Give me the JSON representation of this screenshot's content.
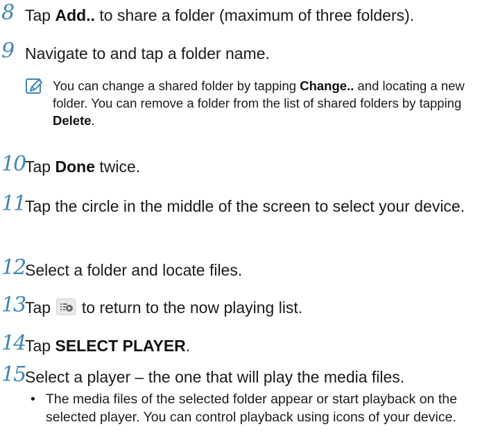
{
  "steps": [
    {
      "num": "8",
      "a": "Tap ",
      "b": "Add..",
      "c": " to share a folder (maximum of three folders)."
    },
    {
      "num": "9",
      "a": "Navigate to and tap a folder name."
    },
    {
      "num": "10",
      "a": "Tap ",
      "b": "Done",
      "c": " twice."
    },
    {
      "num": "11",
      "a": "Tap the circle in the middle of the screen to select your device."
    },
    {
      "num": "12",
      "a": "Select a folder and locate files."
    },
    {
      "num": "13",
      "a": "Tap ",
      "c": " to return to the now playing list."
    },
    {
      "num": "14",
      "a": "Tap ",
      "b": "SELECT PLAYER",
      "c": "."
    },
    {
      "num": "15",
      "a": "Select a player – the one that will play the media files."
    }
  ],
  "note": {
    "p1": "You can change a shared folder by tapping ",
    "b1": "Change..",
    "p2": " and locating a new folder. You can remove a folder from the list of shared folders by tapping ",
    "b2": "Delete",
    "p3": "."
  },
  "bullet": {
    "dot": "•",
    "text": "The media files of the selected folder appear or start playback on the selected player. You can control playback using icons of your device."
  },
  "icons": {
    "note_icon": "note-pencil-icon",
    "now_playing_icon": "now-playing-list-icon"
  },
  "colors": {
    "step_number": "#3f86b4",
    "note_icon": "#3f86b4"
  }
}
